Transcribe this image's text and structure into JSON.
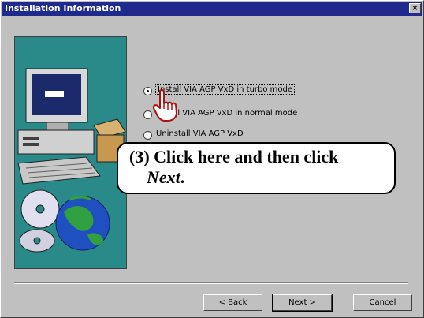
{
  "window": {
    "title": "Installation Information",
    "close_label": "×"
  },
  "options": [
    {
      "label": "Install VIA AGP VxD in turbo mode",
      "checked": true,
      "focused": true
    },
    {
      "label": "Install VIA AGP VxD in normal mode",
      "checked": false,
      "focused": false
    },
    {
      "label": "Uninstall VIA AGP VxD",
      "checked": false,
      "focused": false
    }
  ],
  "callout": {
    "line1": "(3) Click here and then click",
    "line2_italic": "Next",
    "line2_suffix": "."
  },
  "buttons": {
    "back": "< Back",
    "next": "Next >",
    "cancel": "Cancel"
  },
  "icons": {
    "illustration": "computer-disks-globe-illustration",
    "pointer": "hand-pointer-icon"
  },
  "colors": {
    "titlebar": "#1f2a8c",
    "dialog_bg": "#c0c0c0",
    "illustration_bg": "#2a8a8a"
  }
}
